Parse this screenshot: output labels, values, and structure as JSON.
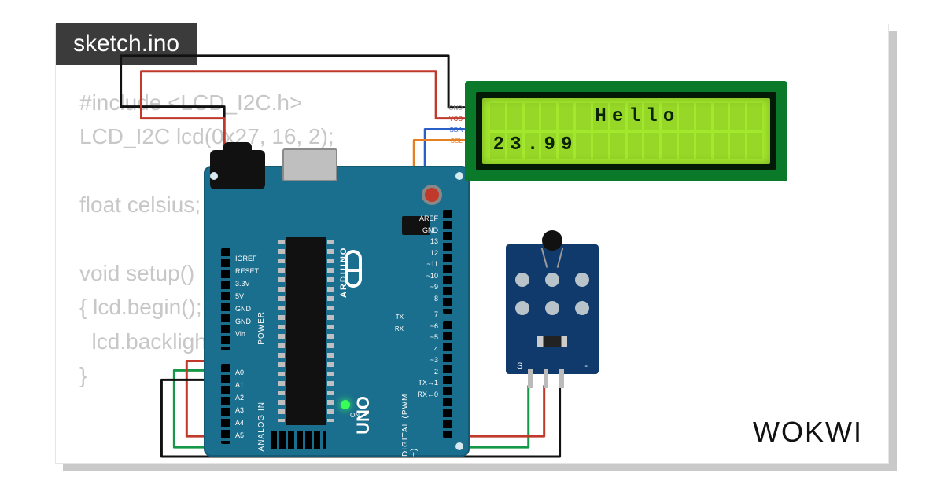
{
  "tab": {
    "filename": "sketch.ino"
  },
  "code": {
    "lines": [
      "#include <LCD_I2C.h>",
      "LCD_I2C lcd(0x27, 16, 2);",
      "",
      "float celsius;",
      "",
      "void setup()",
      "{ lcd.begin();",
      "  lcd.backlight();",
      "}"
    ]
  },
  "lcd": {
    "line1": "      Hello     ",
    "line2": "23.99           ",
    "pin_labels": [
      "GND",
      "VCC",
      "SDA",
      "SCL"
    ]
  },
  "arduino": {
    "board_name": "UNO",
    "brand": "ARDUINO",
    "right_pins": [
      "",
      "AREF",
      "GND",
      "13",
      "12",
      "~11",
      "~10",
      "~9",
      "8",
      "",
      "7",
      "~6",
      "~5",
      "4",
      "~3",
      "2",
      "TX→1",
      "RX←0"
    ],
    "power_pins": [
      "IOREF",
      "RESET",
      "3.3V",
      "5V",
      "GND",
      "GND",
      "Vin"
    ],
    "analog_pins": [
      "A0",
      "A1",
      "A2",
      "A3",
      "A4",
      "A5"
    ],
    "digital_label": "DIGITAL (PWM ~)",
    "power_label": "POWER",
    "analog_label": "ANALOG IN",
    "on_label": "ON",
    "txrx": "TX\nRX"
  },
  "ntc": {
    "pin_labels": {
      "signal": "S",
      "ground": "-"
    }
  },
  "branding": {
    "logo": "WOKWI"
  }
}
